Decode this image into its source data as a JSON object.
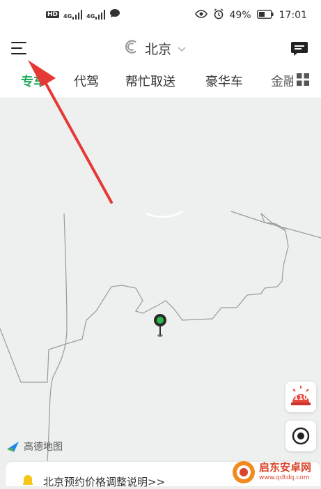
{
  "status_bar": {
    "left_icons": [
      "hd-icon",
      "signal-4g-icon",
      "signal-4g-icon",
      "chat-bubble-icon"
    ],
    "hd_label": "HD",
    "net1_label": "4G",
    "net2_label": "4G",
    "battery_percent": "49%",
    "time": "17:01"
  },
  "header": {
    "city": "北京"
  },
  "tabs": [
    {
      "label": "专车",
      "active": true
    },
    {
      "label": "代驾",
      "active": false
    },
    {
      "label": "帮忙取送",
      "active": false
    },
    {
      "label": "豪华车",
      "active": false
    },
    {
      "label": "金融",
      "active": false
    }
  ],
  "map": {
    "logo": "高德地图",
    "pin_color": "#2db84c"
  },
  "sos": {
    "label": "110",
    "color": "#e8473b"
  },
  "notice": {
    "text": "北京预约价格调整说明>>"
  },
  "watermark": {
    "title": "启东安卓网",
    "url": "www.qdtdq.com"
  },
  "colors": {
    "accent": "#1aa85a",
    "arrow": "#e53935"
  }
}
